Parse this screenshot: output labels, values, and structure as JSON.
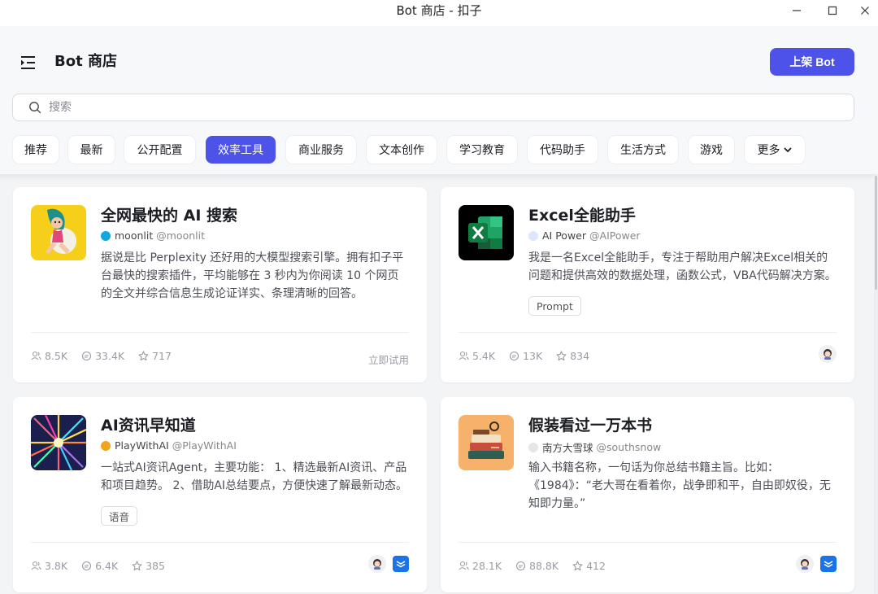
{
  "window": {
    "title": "Bot 商店 - 扣子"
  },
  "header": {
    "title": "Bot 商店",
    "publish_label": "上架 Bot"
  },
  "search": {
    "placeholder": "搜索"
  },
  "tabs": [
    {
      "label": "推荐"
    },
    {
      "label": "最新"
    },
    {
      "label": "公开配置"
    },
    {
      "label": "效率工具",
      "active": true
    },
    {
      "label": "商业服务"
    },
    {
      "label": "文本创作"
    },
    {
      "label": "学习教育"
    },
    {
      "label": "代码助手"
    },
    {
      "label": "生活方式"
    },
    {
      "label": "游戏"
    },
    {
      "label": "更多"
    }
  ],
  "cards": [
    {
      "name": "全网最快的 AI 搜索",
      "author_name": "moonlit",
      "author_handle": "@moonlit",
      "description": "据说是比 Perplexity 还好用的大模型搜索引擎。拥有扣子平台最快的搜索插件，平均能够在 3 秒内为你阅读 10 个网页的全文并综合信息生成论证详实、条理清晰的回答。",
      "users": "8.5K",
      "chats": "33.4K",
      "stars": "717",
      "action_label": "立即试用"
    },
    {
      "name": "Excel全能助手",
      "author_name": "AI Power",
      "author_handle": "@AIPower",
      "description": "我是一名Excel全能助手，专注于帮助用户解决Excel相关的问题和提供高效的数据处理，函数公式，VBA代码解决方案。",
      "tag": "Prompt",
      "users": "5.4K",
      "chats": "13K",
      "stars": "834"
    },
    {
      "name": "AI资讯早知道",
      "author_name": "PlayWithAI",
      "author_handle": "@PlayWithAI",
      "description": "一站式AI资讯Agent，主要功能： 1、精选最新AI资讯、产品和项目趋势。 2、借助AI总结要点，方便快速了解最新动态。",
      "tag": "语音",
      "users": "3.8K",
      "chats": "6.4K",
      "stars": "385"
    },
    {
      "name": "假装看过一万本书",
      "author_name": "南方大雪球",
      "author_handle": "@southsnow",
      "description": "输入书籍名称，一句话为你总结书籍主旨。比如：《1984》：“老大哥在看着你，战争即和平，自由即奴役，无知即力量。”",
      "users": "28.1K",
      "chats": "88.8K",
      "stars": "412"
    }
  ],
  "colors": {
    "accent": "#4d53e8",
    "background": "#f3f4f6",
    "card": "#ffffff"
  }
}
